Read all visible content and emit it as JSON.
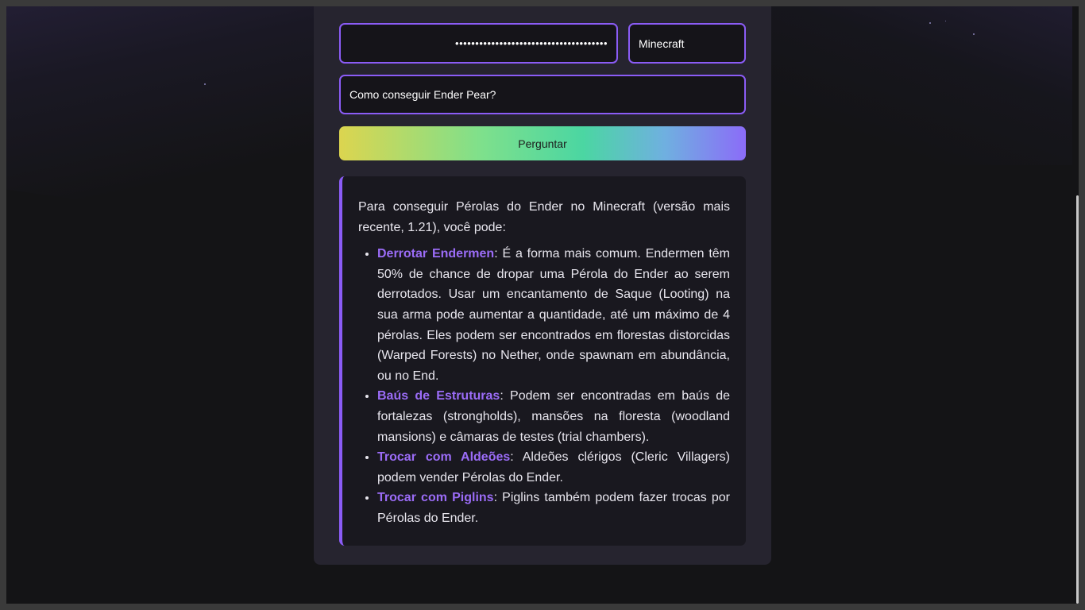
{
  "form": {
    "api_key_value": "••••••••••••••••••••••••••••••••••••••",
    "game_value": "Minecraft",
    "question_value": "Como conseguir Ender Pear?",
    "ask_button_label": "Perguntar"
  },
  "answer": {
    "intro": "Para conseguir Pérolas do Ender no Minecraft (versão mais recente, 1.21), você pode:",
    "items": [
      {
        "title": "Derrotar Endermen",
        "text": ": É a forma mais comum. Endermen têm 50% de chance de dropar uma Pérola do Ender ao serem derrotados. Usar um encantamento de Saque (Looting) na sua arma pode aumentar a quantidade, até um máximo de 4 pérolas. Eles podem ser encontrados em florestas distorcidas (Warped Forests) no Nether, onde spawnam em abundância, ou no End."
      },
      {
        "title": "Baús de Estruturas",
        "text": ": Podem ser encontradas em baús de fortalezas (strongholds), mansões na floresta (woodland mansions) e câmaras de testes (trial chambers)."
      },
      {
        "title": "Trocar com Aldeões",
        "text": ": Aldeões clérigos (Cleric Villagers) podem vender Pérolas do Ender."
      },
      {
        "title": "Trocar com Piglins",
        "text": ": Piglins também podem fazer trocas por Pérolas do Ender."
      }
    ]
  },
  "colors": {
    "accent": "#8b5cf6",
    "card_background": "#26242f",
    "page_background": "#141416"
  }
}
